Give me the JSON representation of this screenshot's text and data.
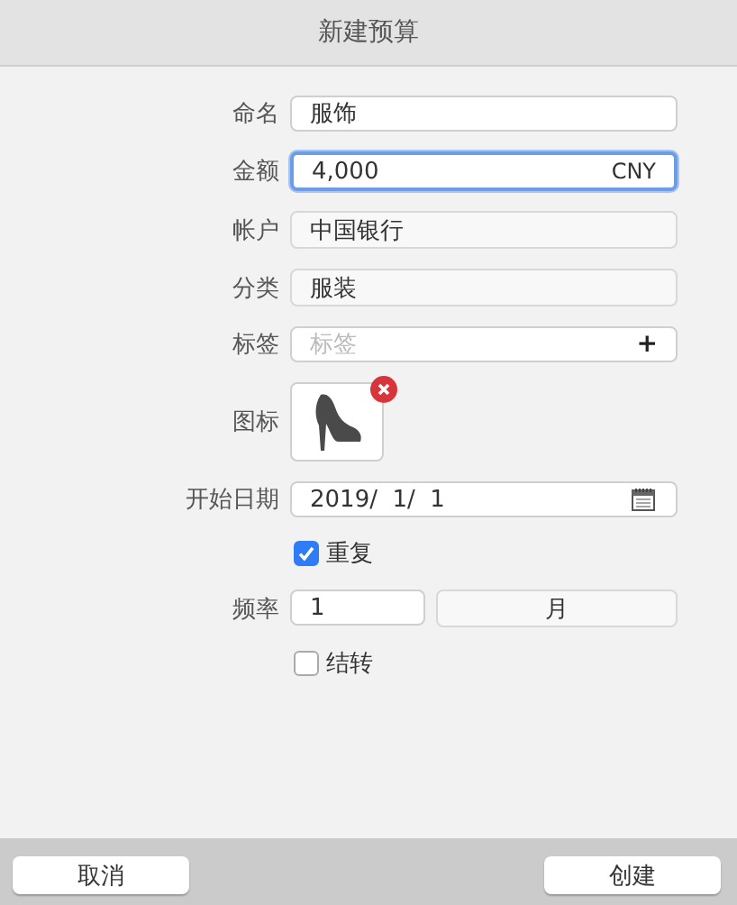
{
  "window": {
    "title": "新建预算"
  },
  "fields": [
    {
      "kind": "text",
      "label": "命名",
      "value": "服饰",
      "focused": false
    },
    {
      "kind": "text",
      "label": "金额",
      "value": "4,000",
      "suffix": "CNY",
      "focused": true
    },
    {
      "kind": "popup",
      "label": "帐户",
      "value": "中国银行"
    },
    {
      "kind": "popup",
      "label": "分类",
      "value": "服装"
    },
    {
      "kind": "tags",
      "label": "标签",
      "placeholder": "标签",
      "action": "+"
    },
    {
      "kind": "icon",
      "label": "图标"
    },
    {
      "kind": "date",
      "label": "开始日期",
      "value": "2019/  1/  1"
    },
    {
      "kind": "checkbox",
      "label": "重复",
      "checked": true
    },
    {
      "kind": "frequency",
      "label": "频率",
      "value": "1",
      "unit": "月"
    },
    {
      "kind": "checkbox",
      "label": "结转",
      "checked": false
    }
  ],
  "buttons": [
    {
      "label": "取消"
    },
    {
      "label": "创建"
    }
  ]
}
